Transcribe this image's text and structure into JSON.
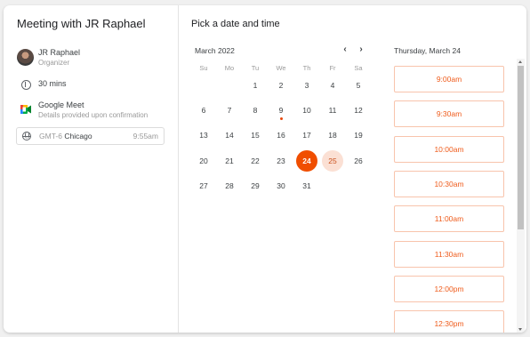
{
  "meeting": {
    "title": "Meeting with JR Raphael",
    "organizer_name": "JR Raphael",
    "organizer_role": "Organizer",
    "duration": "30 mins",
    "location": "Google Meet",
    "location_note": "Details provided upon confirmation",
    "timezone_gmt": "GMT-6",
    "timezone_city": "Chicago",
    "timezone_time": "9:55am"
  },
  "calendar": {
    "heading": "Pick a date and time",
    "month_label": "March 2022",
    "prev": "‹",
    "next": "›",
    "weekdays": [
      "Su",
      "Mo",
      "Tu",
      "We",
      "Th",
      "Fr",
      "Sa"
    ],
    "weeks": [
      [
        "",
        "",
        "1",
        "2",
        "3",
        "4",
        "5"
      ],
      [
        "6",
        "7",
        "8",
        "9",
        "10",
        "11",
        "12"
      ],
      [
        "13",
        "14",
        "15",
        "16",
        "17",
        "18",
        "19"
      ],
      [
        "20",
        "21",
        "22",
        "23",
        "24",
        "25",
        "26"
      ],
      [
        "27",
        "28",
        "29",
        "30",
        "31",
        "",
        ""
      ]
    ],
    "selected_day": "24",
    "highlighted_day": "25",
    "today_dot_day": "9"
  },
  "slots": {
    "date_heading": "Thursday, March 24",
    "times": [
      "9:00am",
      "9:30am",
      "10:00am",
      "10:30am",
      "11:00am",
      "11:30am",
      "12:00pm",
      "12:30pm"
    ]
  },
  "colors": {
    "accent": "#f04e00",
    "accent_light": "#fbe0d4",
    "slot_text": "#ef5b1b",
    "slot_border": "#f8c4ac"
  },
  "icons": {
    "duration": "timer-icon",
    "location": "google-meet-icon",
    "timezone": "globe-icon"
  }
}
